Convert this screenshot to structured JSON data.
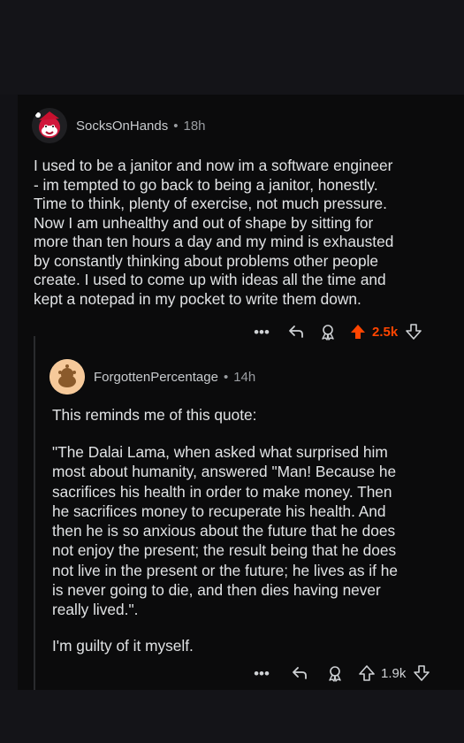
{
  "comments": [
    {
      "username": "SocksOnHands",
      "age": "18h",
      "body": "I used to be a janitor and now im a software engineer\n- im tempted to go back to being a janitor, honestly.\nTime to think, plenty of exercise, not much pressure.\nNow I am unhealthy and out of shape by sitting for\nmore than ten hours a day and my mind is exhausted\nby constantly thinking about problems other people\ncreate.  I used to come up with ideas all the time and\nkept a notepad in my pocket to write them down.",
      "votes": "2.5k",
      "upvoted": true,
      "avatar": "reddit-snoo-avatar-red-santa-hat"
    },
    {
      "username": "ForgottenPercentage",
      "age": "14h",
      "body_p1": "This reminds me of this quote:",
      "body_p2": "\"The Dalai Lama, when asked what surprised him\nmost about humanity, answered \"Man! Because he\nsacrifices his health in order to make money. Then\nhe sacrifices money to recuperate his health. And\nthen he is so anxious about the future that he does\nnot enjoy the present; the result being that he does\nnot live in the present or the future; he lives as if he\nis never going to die, and then dies having never\nreally lived.\".",
      "body_p3": "I'm guilty of it myself.",
      "votes": "1.9k",
      "upvoted": false,
      "avatar": "default-snoo-avatar"
    }
  ],
  "icons": {
    "more": "more-options-icon",
    "reply": "reply-icon",
    "award": "award-icon",
    "upvote": "upvote-arrow-icon",
    "downvote": "downvote-arrow-icon"
  },
  "colors": {
    "background": "#0b0b0c",
    "text": "#e1e3e5",
    "muted": "#9a9da1",
    "upvote_active": "#ff4500",
    "vote_count_active": "#ff4500"
  },
  "more_glyph": "•••"
}
